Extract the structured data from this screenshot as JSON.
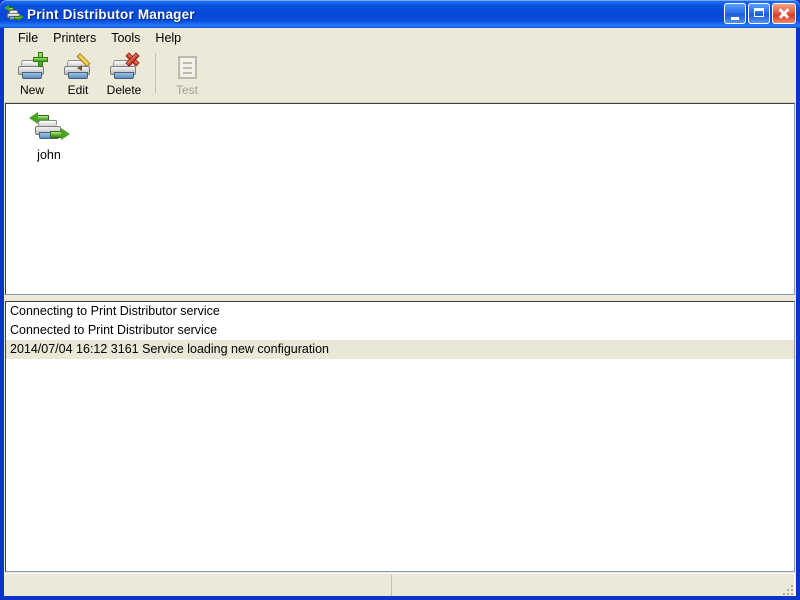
{
  "window": {
    "title": "Print Distributor Manager",
    "title_icon": "printer-sync-icon",
    "controls": {
      "minimize_label": "Minimize",
      "maximize_label": "Maximize",
      "close_label": "Close"
    }
  },
  "menubar": {
    "items": [
      {
        "label": "File"
      },
      {
        "label": "Printers"
      },
      {
        "label": "Tools"
      },
      {
        "label": "Help"
      }
    ]
  },
  "toolbar": {
    "buttons": [
      {
        "label": "New",
        "icon": "printer-add-icon",
        "enabled": true
      },
      {
        "label": "Edit",
        "icon": "printer-edit-icon",
        "enabled": true
      },
      {
        "label": "Delete",
        "icon": "printer-delete-icon",
        "enabled": true
      },
      {
        "label": "Test",
        "icon": "test-page-icon",
        "enabled": false
      }
    ]
  },
  "printers_pane": {
    "items": [
      {
        "label": "john",
        "icon": "printer-sync-icon"
      }
    ]
  },
  "log_pane": {
    "lines": [
      {
        "text": "Connecting to Print Distributor service",
        "highlighted": false
      },
      {
        "text": "Connected to Print Distributor service",
        "highlighted": false
      },
      {
        "text": "2014/07/04 16:12 3161 Service loading new configuration",
        "highlighted": true
      }
    ]
  },
  "statusbar": {
    "panel1": "",
    "panel2": ""
  },
  "colors": {
    "titlebar_blue": "#0a4fe0",
    "window_border": "#0a36c8",
    "client_bg": "#ece9d8",
    "pane_bg": "#ffffff",
    "log_highlight": "#eae7d6",
    "close_red": "#d43d21",
    "icon_green": "#4aa320"
  }
}
